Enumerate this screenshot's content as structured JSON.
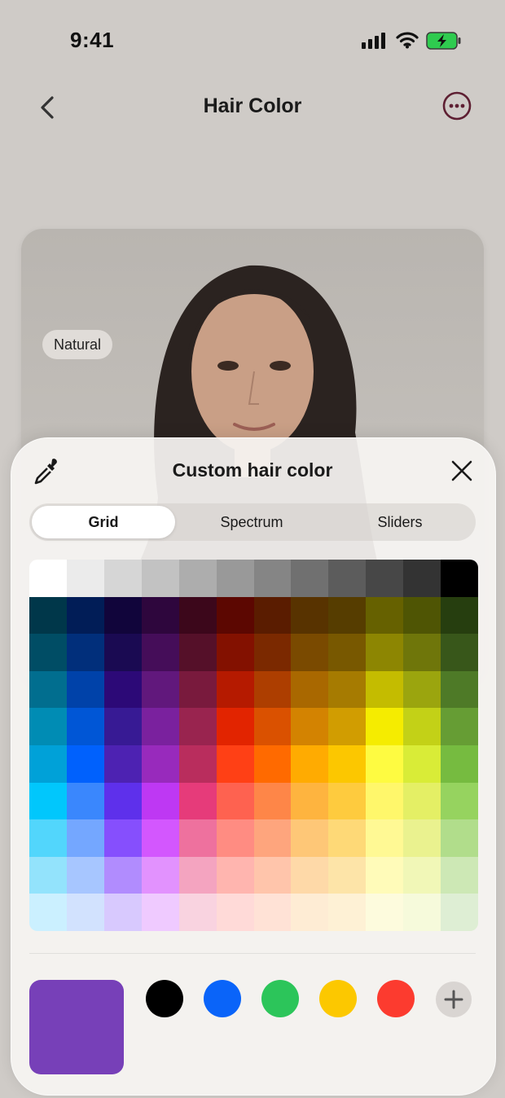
{
  "status_bar": {
    "time": "9:41",
    "icons": [
      "signal-icon",
      "wifi-icon",
      "battery-charging-icon"
    ]
  },
  "nav": {
    "title": "Hair Color",
    "back_icon": "chevron-left-icon",
    "more_icon": "ellipsis-circle-icon"
  },
  "photo": {
    "badge": "Natural"
  },
  "sheet": {
    "title": "Custom hair color",
    "eyedropper_icon": "eyedropper-icon",
    "close_icon": "close-icon",
    "tabs": [
      {
        "label": "Grid",
        "active": true
      },
      {
        "label": "Spectrum",
        "active": false
      },
      {
        "label": "Sliders",
        "active": false
      }
    ],
    "grid_colors": [
      [
        "#ffffff",
        "#ebebeb",
        "#d6d6d6",
        "#c2c2c2",
        "#adadad",
        "#999999",
        "#858585",
        "#707070",
        "#5c5c5c",
        "#474747",
        "#333333",
        "#000000"
      ],
      [
        "#00374a",
        "#011d57",
        "#11053b",
        "#2e063d",
        "#3c071b",
        "#5c0701",
        "#5a1c00",
        "#583300",
        "#563d00",
        "#666100",
        "#4f5504",
        "#263e0f"
      ],
      [
        "#004d65",
        "#012f7b",
        "#1a0a52",
        "#450d59",
        "#551029",
        "#831100",
        "#7b2900",
        "#7a4a00",
        "#785800",
        "#8d8602",
        "#6f760a",
        "#38571a"
      ],
      [
        "#016e8f",
        "#0042a9",
        "#2c0977",
        "#61187c",
        "#791a3d",
        "#b51a00",
        "#ad3e00",
        "#a96800",
        "#a67b01",
        "#c4bc00",
        "#9ba50e",
        "#4e7a27"
      ],
      [
        "#008cb4",
        "#0056d6",
        "#371a94",
        "#7a219e",
        "#99244f",
        "#e22400",
        "#da5100",
        "#d38301",
        "#d19d01",
        "#f5ec00",
        "#c3d117",
        "#669d34"
      ],
      [
        "#00a1d8",
        "#0061fd",
        "#4d22b2",
        "#982abc",
        "#b92d5d",
        "#ff4015",
        "#ff6a00",
        "#ffab01",
        "#fcc700",
        "#fefb41",
        "#d9ec37",
        "#76bb40"
      ],
      [
        "#01c7fc",
        "#3a87fd",
        "#5e30eb",
        "#be38f3",
        "#e63b7a",
        "#fe6250",
        "#fe8648",
        "#feb43f",
        "#fecb3e",
        "#fff76b",
        "#e4ef65",
        "#96d35f"
      ],
      [
        "#52d6fc",
        "#74a7ff",
        "#864ffd",
        "#d357fe",
        "#ee719e",
        "#ff8c82",
        "#fea57d",
        "#fec777",
        "#fed977",
        "#fff994",
        "#eaf28f",
        "#b1dd8b"
      ],
      [
        "#93e3fc",
        "#a7c6ff",
        "#b18cfe",
        "#e292fe",
        "#f4a4c0",
        "#ffb5af",
        "#ffc5ab",
        "#fed9a8",
        "#fde4a8",
        "#fffbb9",
        "#f1f7b7",
        "#cde8b5"
      ],
      [
        "#cbf0ff",
        "#d2e2fe",
        "#d8c9fe",
        "#efcaff",
        "#f9d3e0",
        "#ffdad8",
        "#ffe2d6",
        "#feecd4",
        "#fef1d5",
        "#fdfbdd",
        "#f6fadb",
        "#deeed4"
      ]
    ],
    "current_color": "#7740b8",
    "swatches": [
      "#000000",
      "#0a64f9",
      "#2cc55a",
      "#fcc800",
      "#fc3b2f"
    ],
    "add_icon": "plus-icon"
  }
}
